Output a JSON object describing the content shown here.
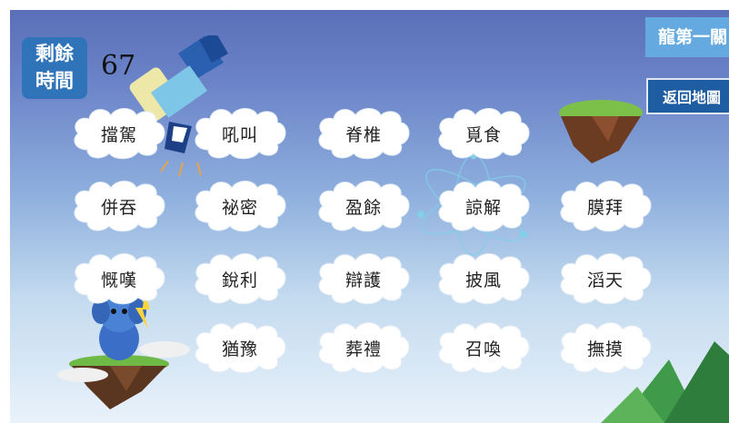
{
  "timer": {
    "label_line1": "剩餘",
    "label_line2": "時間",
    "value": "67"
  },
  "level_tab": {
    "label": "龍第一關"
  },
  "map_button": {
    "label": "返回地圖"
  },
  "cards": [
    "擋駕",
    "吼叫",
    "脊椎",
    "覓食",
    "併吞",
    "祕密",
    "盈餘",
    "諒解",
    "膜拜",
    "慨嘆",
    "銳利",
    "辯護",
    "披風",
    "滔天",
    "猶豫",
    "葬禮",
    "召喚",
    "撫摸"
  ],
  "colors": {
    "timer_bg": "#2f73b8",
    "tab_bg": "#64a9e0",
    "map_btn_bg": "#1e5da1",
    "cloud": "#ffffff"
  },
  "icons": [
    "telescope-icon",
    "floating-island-icon",
    "elephant-mascot-icon",
    "orbit-icon",
    "mountain-icon"
  ]
}
